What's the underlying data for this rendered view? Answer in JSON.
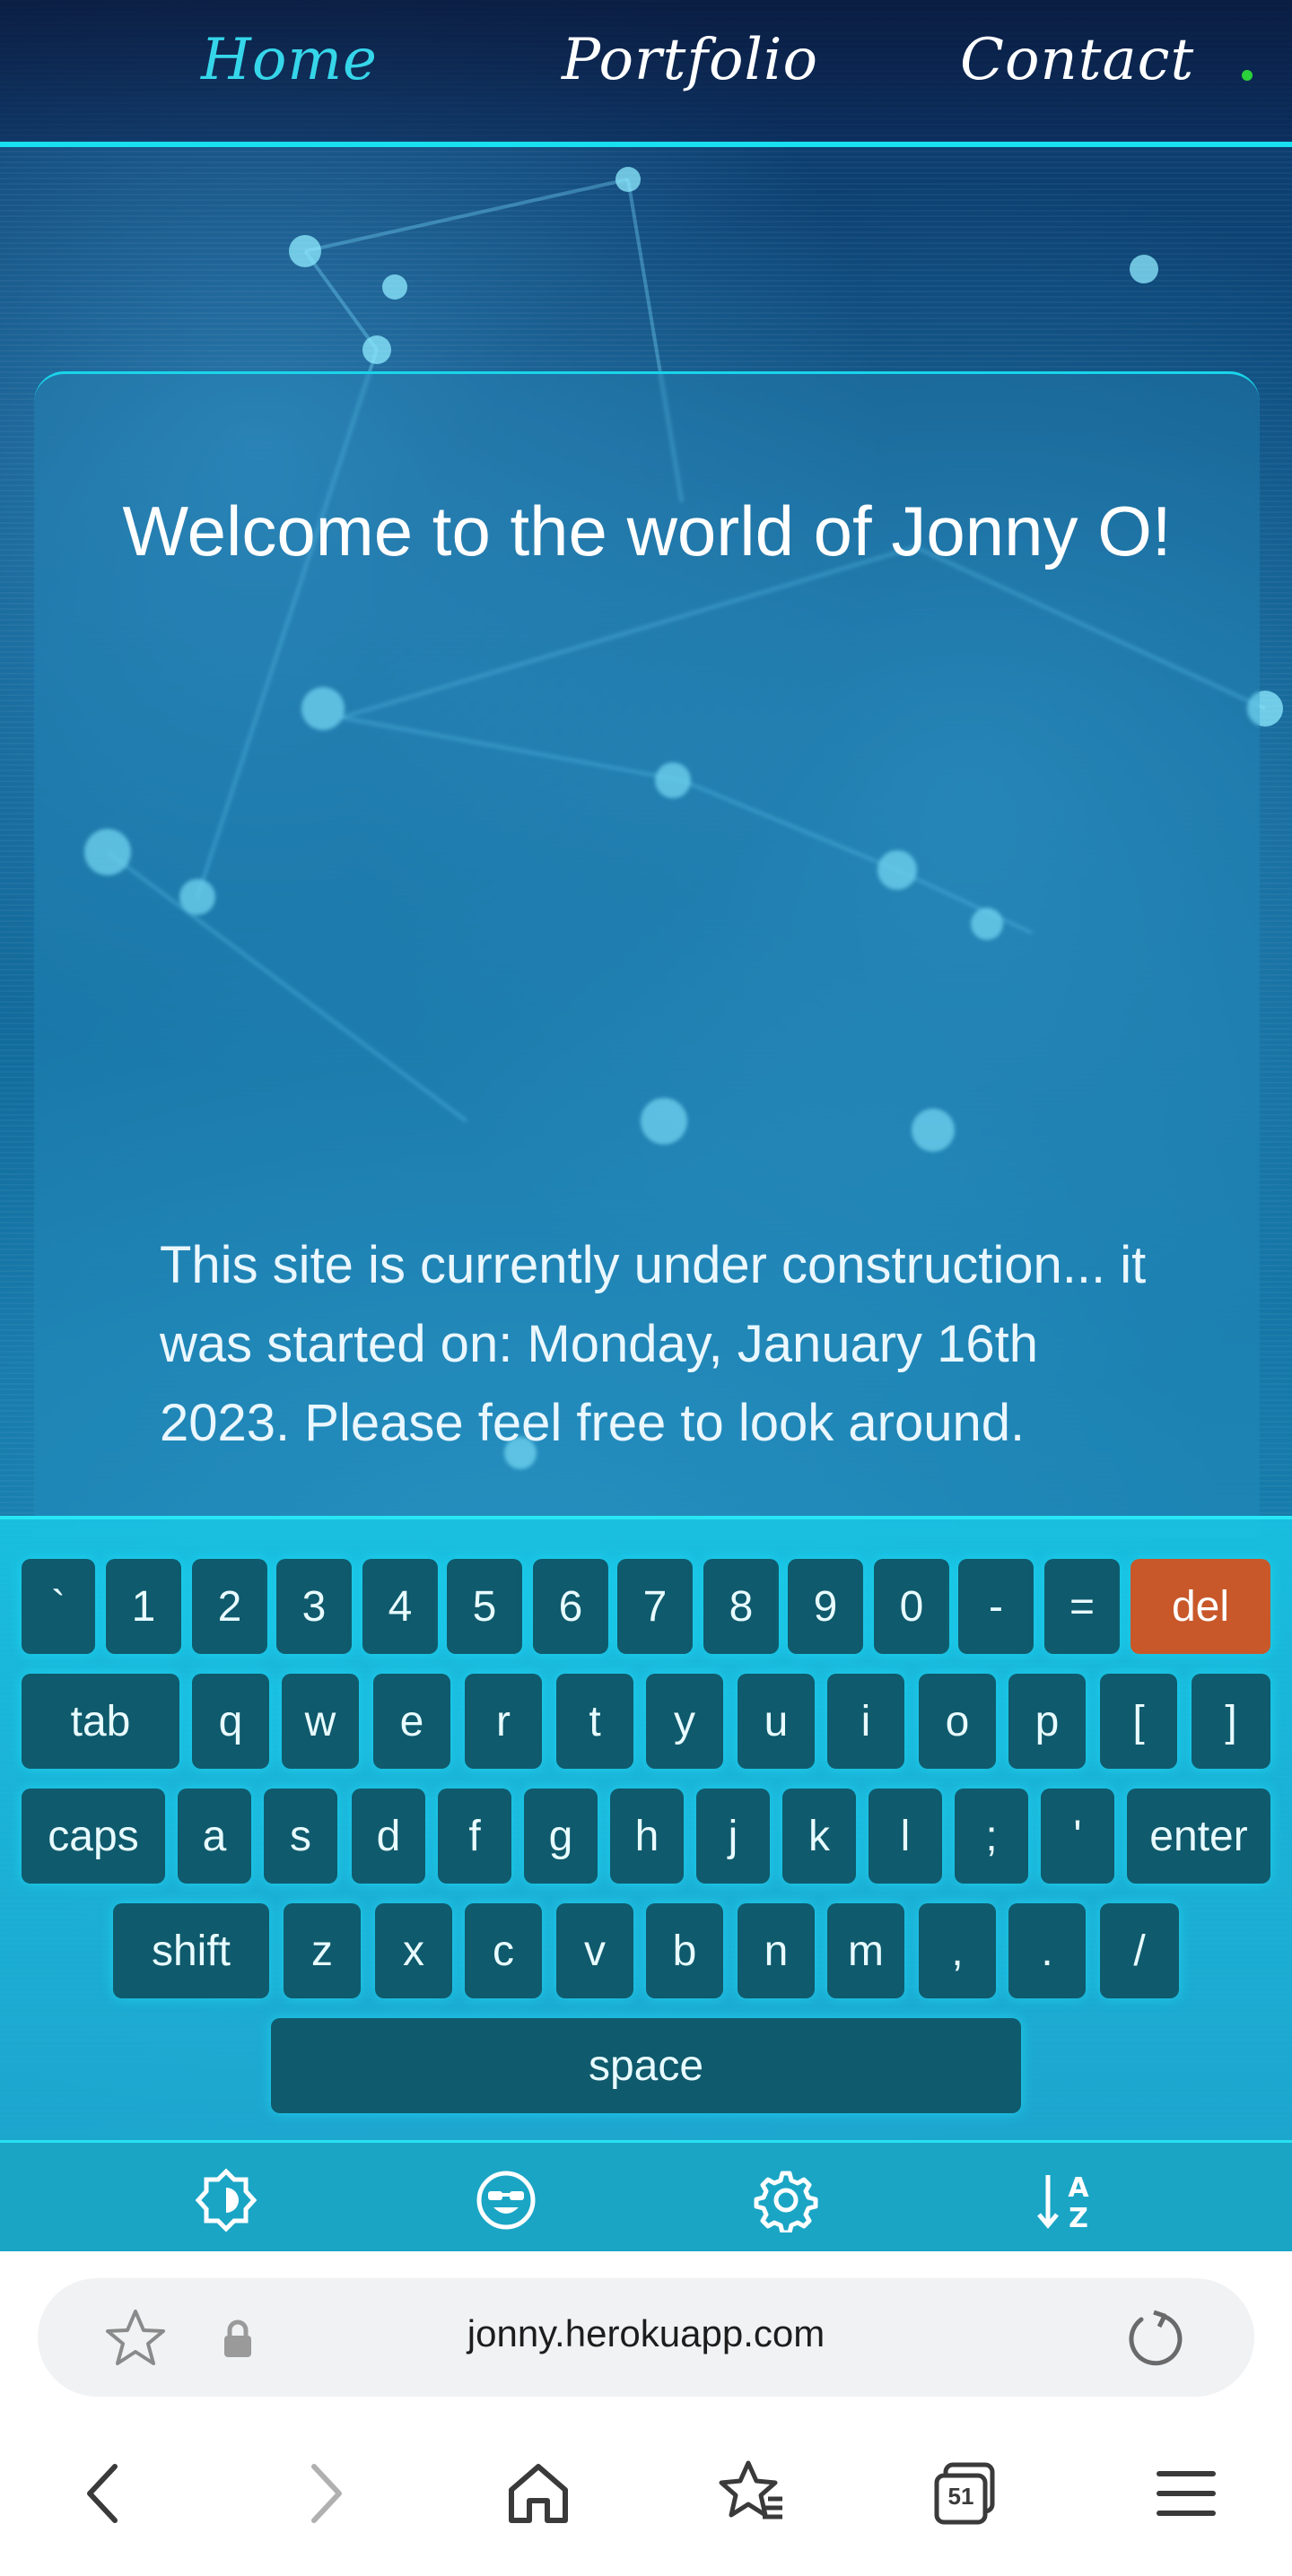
{
  "nav": {
    "items": [
      {
        "label": "Home",
        "active": true
      },
      {
        "label": "Portfolio",
        "active": false
      },
      {
        "label": "Contact",
        "active": false
      }
    ]
  },
  "card": {
    "heading": "Welcome to the world of Jonny O!",
    "body": "This site is currently under construction... it was started on: Monday, January 16th 2023. Please feel free to look around."
  },
  "keyboard": {
    "row1": [
      "`",
      "1",
      "2",
      "3",
      "4",
      "5",
      "6",
      "7",
      "8",
      "9",
      "0",
      "-",
      "=",
      "del"
    ],
    "row2": [
      "tab",
      "q",
      "w",
      "e",
      "r",
      "t",
      "y",
      "u",
      "i",
      "o",
      "p",
      "[",
      "]"
    ],
    "row3": [
      "caps",
      "a",
      "s",
      "d",
      "f",
      "g",
      "h",
      "j",
      "k",
      "l",
      ";",
      "'",
      "enter"
    ],
    "row4": [
      "shift",
      "z",
      "x",
      "c",
      "v",
      "b",
      "n",
      "m",
      ",",
      ".",
      "/"
    ],
    "row5": [
      "space"
    ]
  },
  "keyboard_toolbar": {
    "icons": [
      "brightness-icon",
      "emoji-icon",
      "settings-icon",
      "sort-az-icon"
    ]
  },
  "browser": {
    "url": "jonny.herokuapp.com",
    "tab_count": "51"
  },
  "colors": {
    "accent": "#19e0f0",
    "del_key": "#c8582a",
    "active_nav": "#36d6ea"
  }
}
